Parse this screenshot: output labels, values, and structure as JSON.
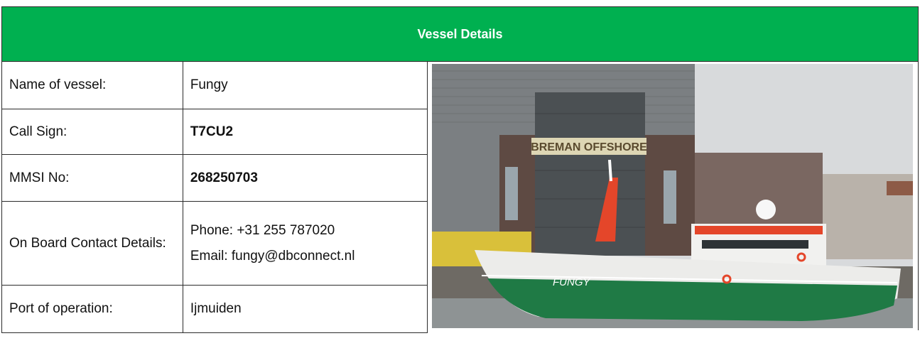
{
  "header": {
    "title": "Vessel Details"
  },
  "rows": [
    {
      "label": "Name of vessel:",
      "value": "Fungy"
    },
    {
      "label": "Call Sign:",
      "value": "T7CU2"
    },
    {
      "label": "MMSI No:",
      "value": "268250703"
    },
    {
      "label": "On Board Contact Details:",
      "phone": "Phone: +31 255 787020",
      "email": "Email: fungy@dbconnect.nl"
    },
    {
      "label": "Port of operation:",
      "value": "Ijmuiden"
    }
  ],
  "photo": {
    "building_sign": "BREMAN OFFSHORE",
    "hull_name": "FUNGY",
    "colors": {
      "hull": "#1f7a45",
      "mast": "#e4462a",
      "header_bg": "#00b050"
    }
  }
}
